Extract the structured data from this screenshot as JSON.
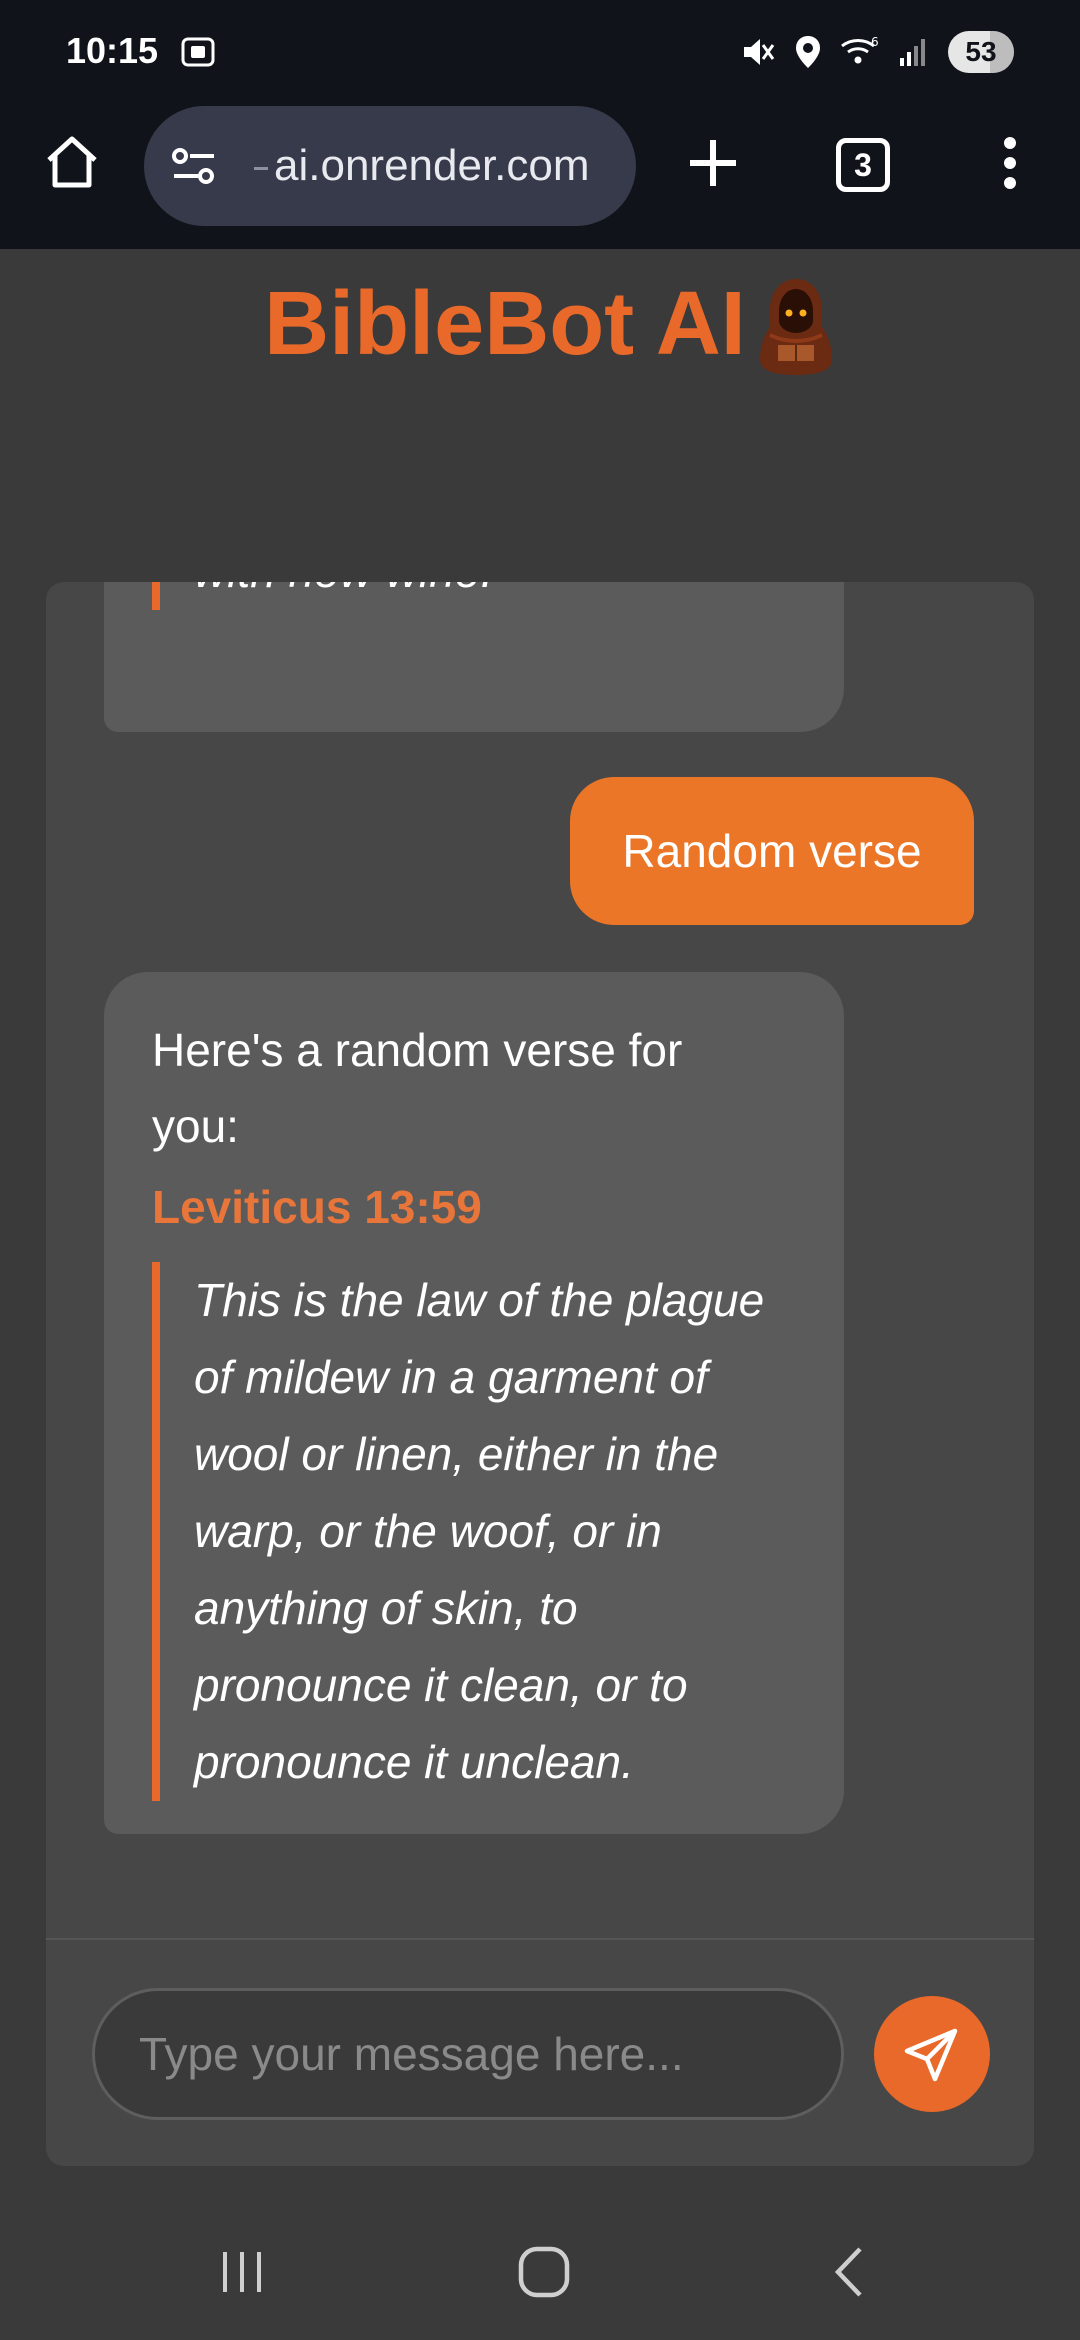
{
  "status_bar": {
    "time": "10:15",
    "battery": "53",
    "icons": [
      "screenshot-icon",
      "mute-icon",
      "location-icon",
      "wifi-icon",
      "signal-icon"
    ]
  },
  "browser": {
    "url": "ai.onrender.com",
    "tab_count": "3",
    "icons": [
      "home-icon",
      "tune-icon",
      "plus-icon",
      "more-vert-icon"
    ]
  },
  "app": {
    "title": "BibleBot AI",
    "accent_color": "#e8692a"
  },
  "chat": {
    "messages": [
      {
        "role": "bot",
        "quote": "and your vats will overflow with new wine."
      },
      {
        "role": "user",
        "text": "Random verse"
      },
      {
        "role": "bot",
        "intro": "Here's a random verse for you:",
        "reference": "Leviticus 13:59",
        "quote": "This is the law of the plague of mildew in a garment of wool or linen, either in the warp, or the woof, or in anything of skin, to pronounce it clean, or to pronounce it unclean."
      }
    ],
    "input": {
      "placeholder": "Type your message here...",
      "value": ""
    }
  },
  "nav": {
    "icons": [
      "recents-icon",
      "home-icon",
      "back-icon"
    ]
  }
}
